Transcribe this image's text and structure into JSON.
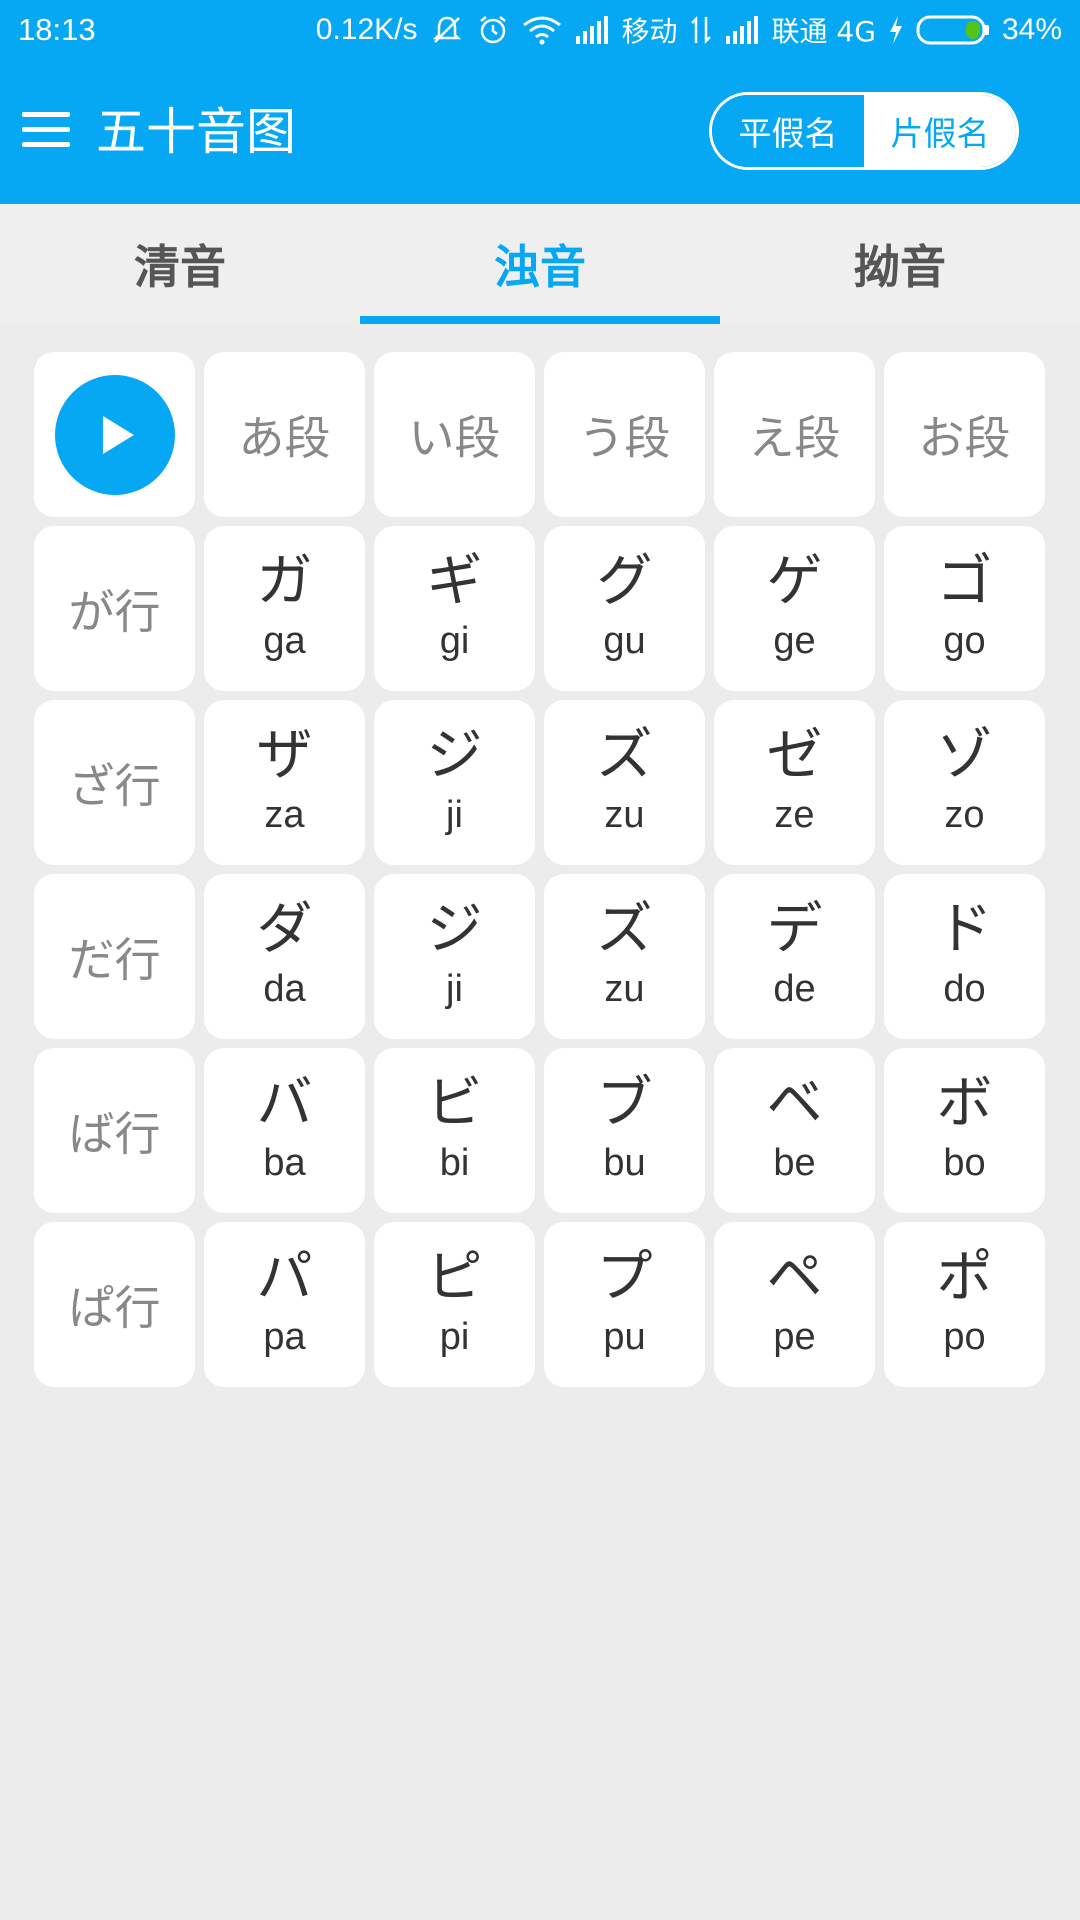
{
  "status_bar": {
    "time": "18:13",
    "net_speed": "0.12K/s",
    "carrier1": "移动",
    "carrier2": "联通 4G",
    "battery": "34%"
  },
  "app_bar": {
    "title": "五十音图",
    "toggle": [
      {
        "label": "平假名",
        "active": false
      },
      {
        "label": "片假名",
        "active": true
      }
    ]
  },
  "tabs": [
    {
      "label": "清音",
      "active": false
    },
    {
      "label": "浊音",
      "active": true
    },
    {
      "label": "拗音",
      "active": false
    }
  ],
  "grid": {
    "column_headers": [
      "あ段",
      "い段",
      "う段",
      "え段",
      "お段"
    ],
    "rows": [
      {
        "label": "が行",
        "cells": [
          {
            "kana": "ガ",
            "romaji": "ga"
          },
          {
            "kana": "ギ",
            "romaji": "gi"
          },
          {
            "kana": "グ",
            "romaji": "gu"
          },
          {
            "kana": "ゲ",
            "romaji": "ge"
          },
          {
            "kana": "ゴ",
            "romaji": "go"
          }
        ]
      },
      {
        "label": "ざ行",
        "cells": [
          {
            "kana": "ザ",
            "romaji": "za"
          },
          {
            "kana": "ジ",
            "romaji": "ji"
          },
          {
            "kana": "ズ",
            "romaji": "zu"
          },
          {
            "kana": "ゼ",
            "romaji": "ze"
          },
          {
            "kana": "ゾ",
            "romaji": "zo"
          }
        ]
      },
      {
        "label": "だ行",
        "cells": [
          {
            "kana": "ダ",
            "romaji": "da"
          },
          {
            "kana": "ジ",
            "romaji": "ji"
          },
          {
            "kana": "ズ",
            "romaji": "zu"
          },
          {
            "kana": "デ",
            "romaji": "de"
          },
          {
            "kana": "ド",
            "romaji": "do"
          }
        ]
      },
      {
        "label": "ば行",
        "cells": [
          {
            "kana": "バ",
            "romaji": "ba"
          },
          {
            "kana": "ビ",
            "romaji": "bi"
          },
          {
            "kana": "ブ",
            "romaji": "bu"
          },
          {
            "kana": "ベ",
            "romaji": "be"
          },
          {
            "kana": "ボ",
            "romaji": "bo"
          }
        ]
      },
      {
        "label": "ぱ行",
        "cells": [
          {
            "kana": "パ",
            "romaji": "pa"
          },
          {
            "kana": "ピ",
            "romaji": "pi"
          },
          {
            "kana": "プ",
            "romaji": "pu"
          },
          {
            "kana": "ペ",
            "romaji": "pe"
          },
          {
            "kana": "ポ",
            "romaji": "po"
          }
        ]
      }
    ]
  },
  "colors": {
    "primary": "#07a8f3",
    "background": "#ececec",
    "cell": "#ffffff",
    "header_text": "#888888",
    "kana_text": "#333333"
  }
}
